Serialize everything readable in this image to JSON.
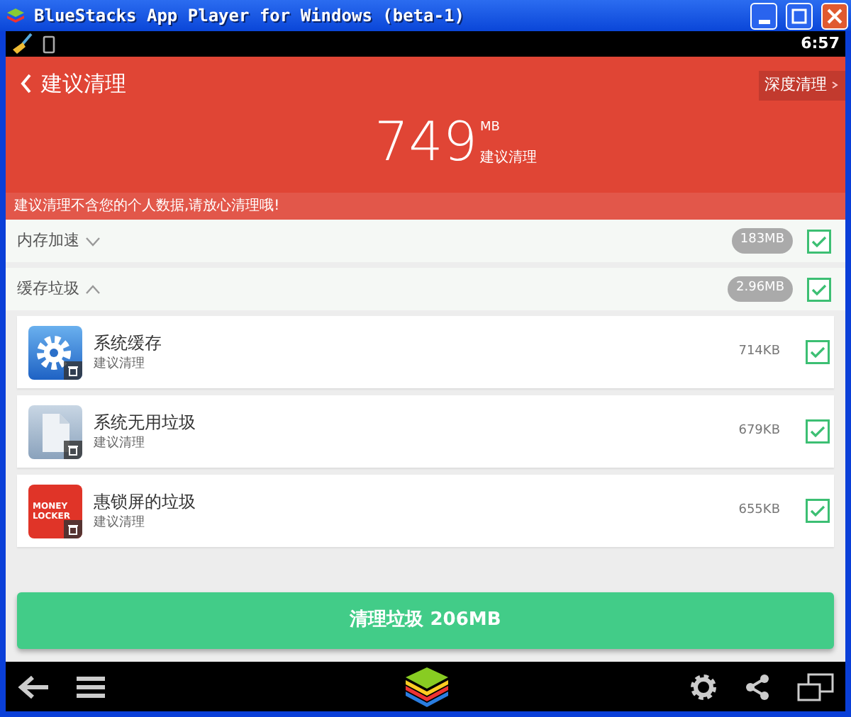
{
  "window": {
    "title": "BlueStacks App Player for Windows (beta-1)"
  },
  "status_bar": {
    "time": "6:57"
  },
  "header": {
    "back": "建议清理",
    "action": "深度清理",
    "amount": "749",
    "unit": "MB",
    "amount_caption": "建议清理"
  },
  "notice": "建议清理不含您的个人数据,请放心清理哦!",
  "sections": [
    {
      "label": "内存加速",
      "expanded": false,
      "size": "183MB",
      "checked": true
    },
    {
      "label": "缓存垃圾",
      "expanded": true,
      "size": "2.96MB",
      "checked": true,
      "items": [
        {
          "kind": "gear",
          "title": "系统缓存",
          "subtitle": "建议清理",
          "size": "714KB",
          "checked": true
        },
        {
          "kind": "file",
          "title": "系统无用垃圾",
          "subtitle": "建议清理",
          "size": "679KB",
          "checked": true
        },
        {
          "kind": "locker",
          "icon_text": "MONEY LOCKER",
          "title": "惠锁屏的垃圾",
          "subtitle": "建议清理",
          "size": "655KB",
          "checked": true
        }
      ]
    }
  ],
  "clean_button": "清理垃圾 206MB"
}
